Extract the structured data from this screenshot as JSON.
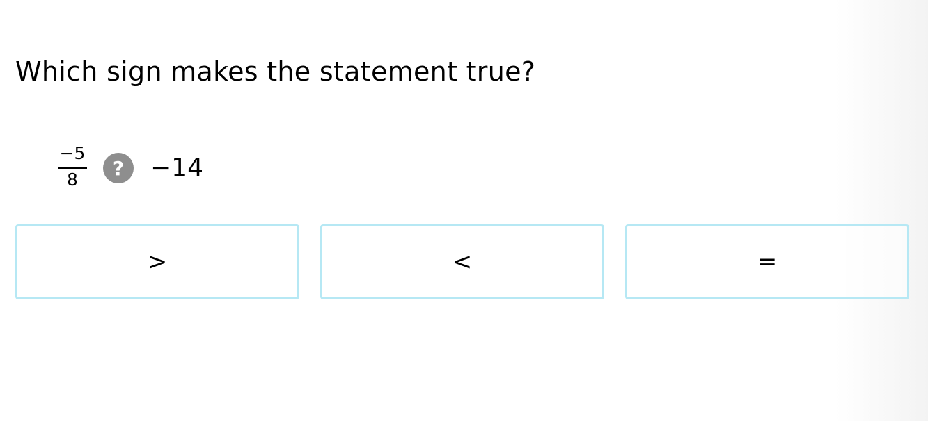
{
  "question": {
    "text": "Which sign makes the statement true?"
  },
  "statement": {
    "left_fraction": {
      "numerator": "−5",
      "denominator": "8"
    },
    "unknown_symbol": "?",
    "right_value": "−14"
  },
  "choices": [
    {
      "label": ">"
    },
    {
      "label": "<"
    },
    {
      "label": "="
    }
  ],
  "colors": {
    "choice_border": "#b6e8f4",
    "unknown_badge": "#8e8e8e"
  }
}
